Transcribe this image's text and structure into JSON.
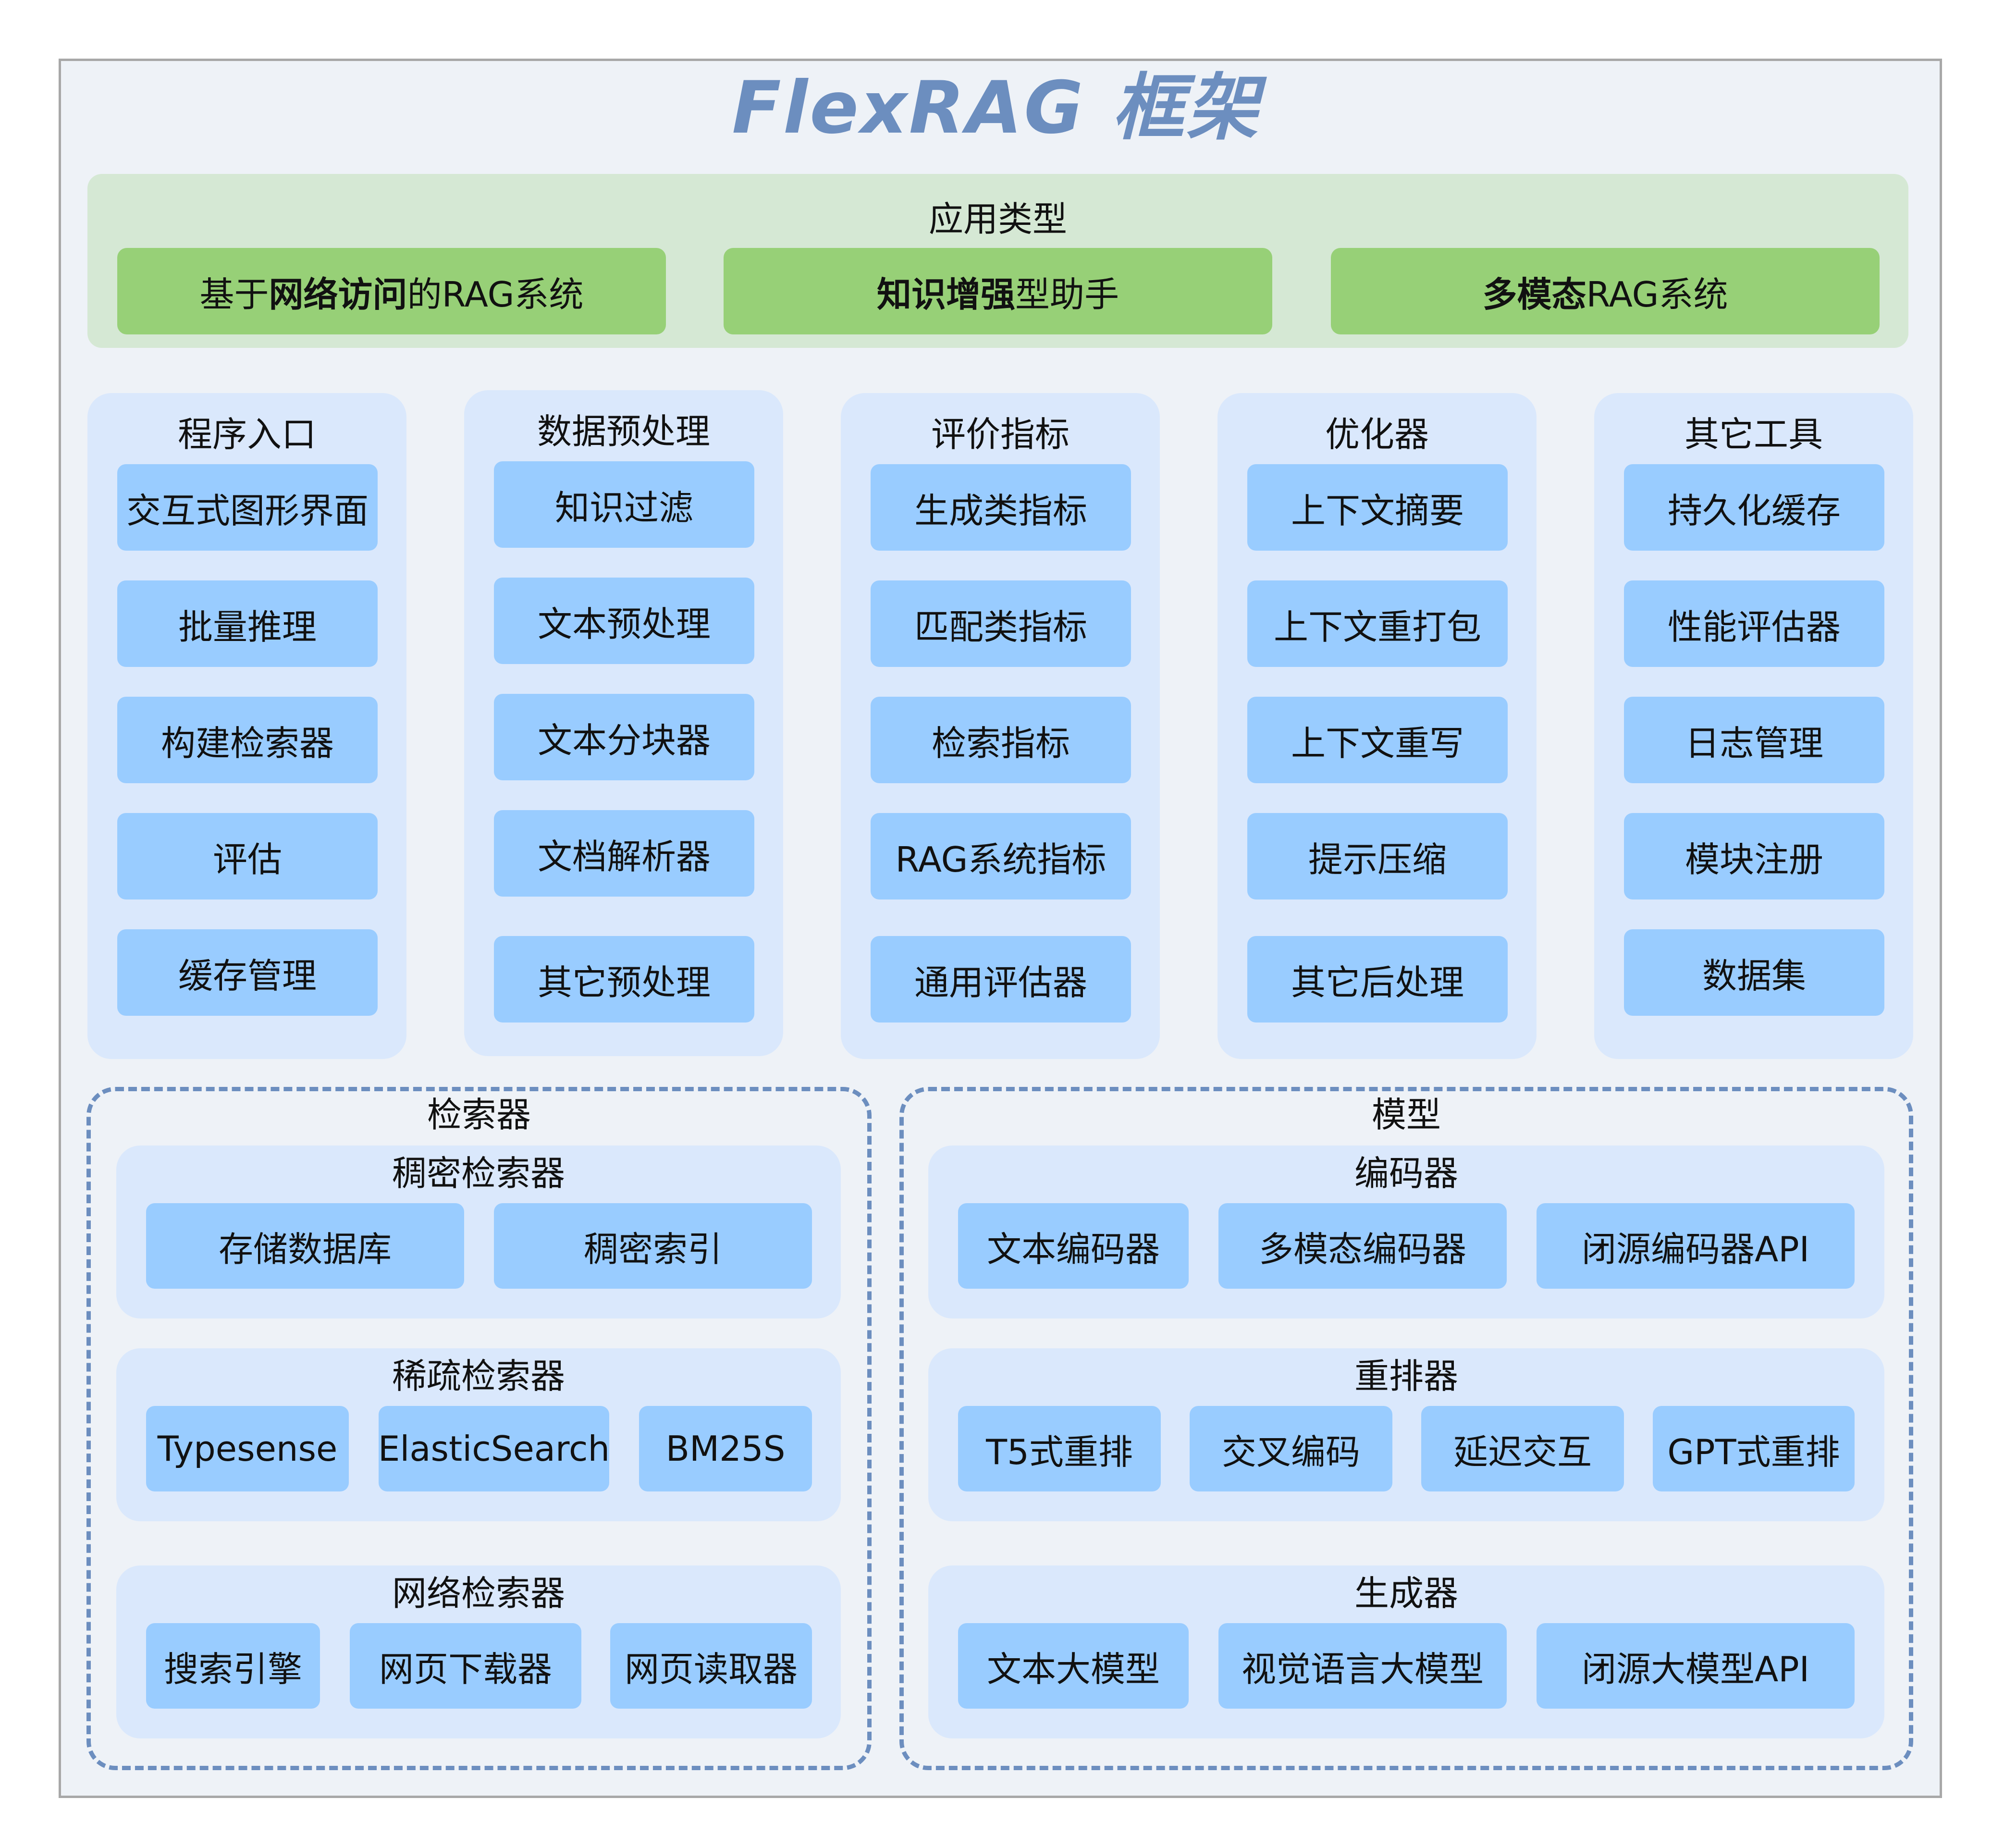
{
  "title": "FlexRAG 框架",
  "application": {
    "label": "应用类型",
    "items": [
      {
        "pre": "基于",
        "bold": "网络访问",
        "post": "的RAG系统"
      },
      {
        "pre": "",
        "bold": "知识增强",
        "post": "型助手"
      },
      {
        "pre": "",
        "bold": "多模态",
        "post": "RAG系统"
      }
    ]
  },
  "columns": [
    {
      "label": "程序入口",
      "items": [
        "交互式图形界面",
        "批量推理",
        "构建检索器",
        "评估",
        "缓存管理"
      ]
    },
    {
      "label": "数据预处理",
      "items": [
        "知识过滤",
        "文本预处理",
        "文本分块器",
        "文档解析器",
        "其它预处理"
      ]
    },
    {
      "label": "评价指标",
      "items": [
        "生成类指标",
        "匹配类指标",
        "检索指标",
        "RAG系统指标",
        "通用评估器"
      ]
    },
    {
      "label": "优化器",
      "items": [
        "上下文摘要",
        "上下文重打包",
        "上下文重写",
        "提示压缩",
        "其它后处理"
      ]
    },
    {
      "label": "其它工具",
      "items": [
        "持久化缓存",
        "性能评估器",
        "日志管理",
        "模块注册",
        "数据集"
      ]
    }
  ],
  "retriever": {
    "label": "检索器",
    "groups": [
      {
        "label": "稠密检索器",
        "items": [
          "存储数据库",
          "稠密索引"
        ]
      },
      {
        "label": "稀疏检索器",
        "items": [
          "Typesense",
          "ElasticSearch",
          "BM25S"
        ]
      },
      {
        "label": "网络检索器",
        "items": [
          "搜索引擎",
          "网页下载器",
          "网页读取器"
        ]
      }
    ]
  },
  "model": {
    "label": "模型",
    "groups": [
      {
        "label": "编码器",
        "items": [
          "文本编码器",
          "多模态编码器",
          "闭源编码器API"
        ]
      },
      {
        "label": "重排器",
        "items": [
          "T5式重排",
          "交叉编码",
          "延迟交互",
          "GPT式重排"
        ]
      },
      {
        "label": "生成器",
        "items": [
          "文本大模型",
          "视觉语言大模型",
          "闭源大模型API"
        ]
      }
    ]
  }
}
